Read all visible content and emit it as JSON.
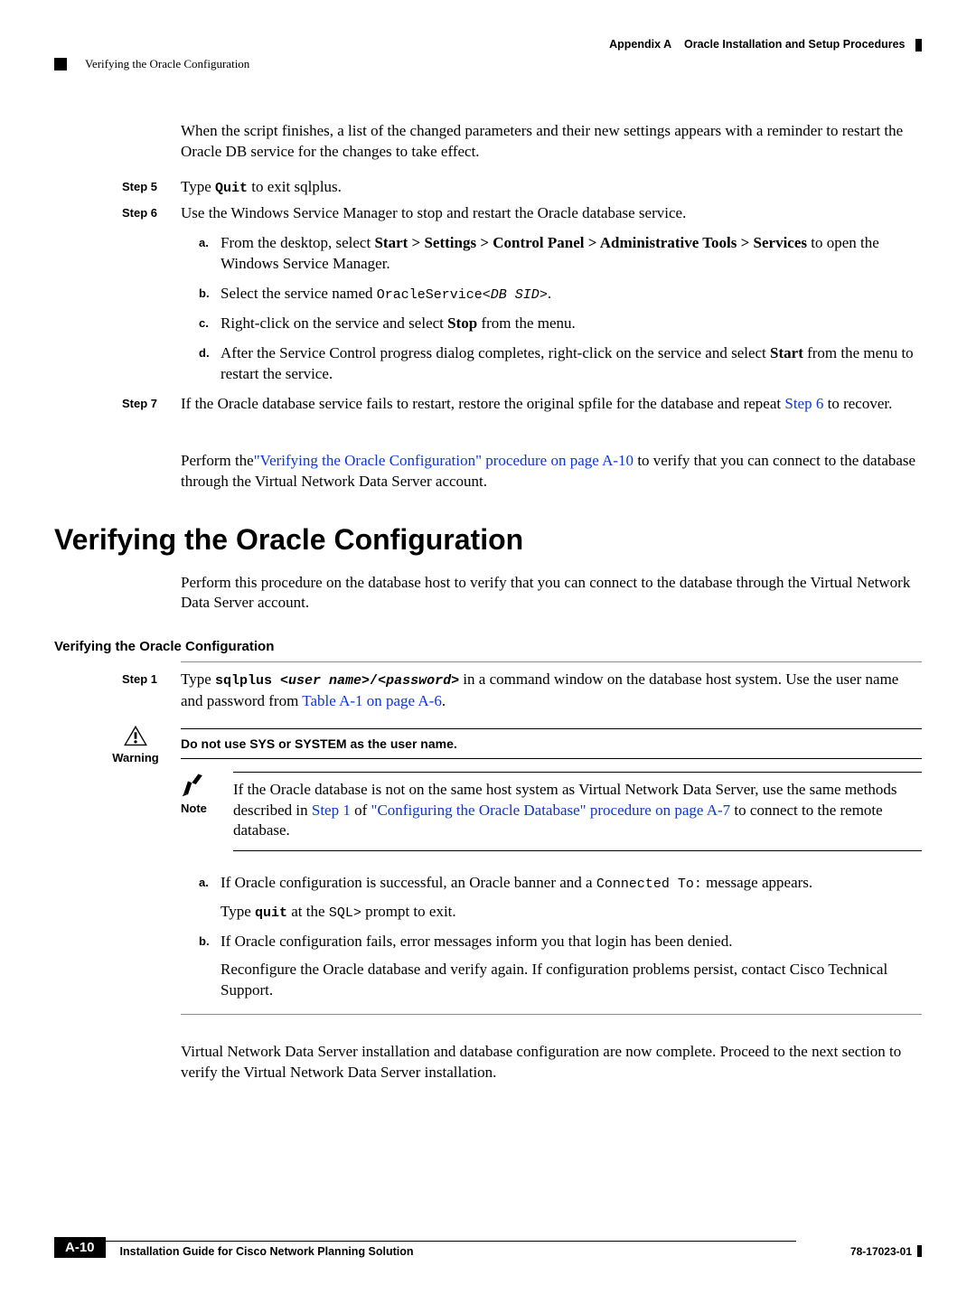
{
  "header": {
    "appendix": "Appendix A",
    "appendix_title": "Oracle Installation and Setup Procedures",
    "section": "Verifying the Oracle Configuration"
  },
  "continuation": {
    "intro": "When the script finishes, a list of the changed parameters and their new settings appears with a reminder to restart the Oracle DB service for the changes to take effect.",
    "step5_label": "Step 5",
    "step5_a": "Type ",
    "step5_cmd": "Quit",
    "step5_b": " to exit sqlplus.",
    "step6_label": "Step 6",
    "step6_text": "Use the Windows Service Manager to stop and restart the Oracle database service.",
    "step6a_a": "From the desktop, select ",
    "step6a_bold": "Start > Settings > Control Panel > Administrative Tools > Services",
    "step6a_b": " to open the Windows Service Manager.",
    "step6b_a": "Select the service named ",
    "step6b_code1": "OracleService<",
    "step6b_code2": "DB SID",
    "step6b_code3": ">",
    "step6b_dot": ".",
    "step6c_a": "Right-click on the service and select ",
    "step6c_bold": "Stop",
    "step6c_b": " from the menu.",
    "step6d_a": "After the Service Control progress dialog completes, right-click on the service and select ",
    "step6d_bold": "Start",
    "step6d_b": " from the menu to restart the service.",
    "step7_label": "Step 7",
    "step7_a": "If the Oracle database service fails to restart, restore the original spfile for the database and repeat ",
    "step7_link": "Step 6",
    "step7_b": " to recover.",
    "perform_a": "Perform the",
    "perform_link": "\"Verifying the Oracle Configuration\" procedure on page A-10",
    "perform_b": " to verify that you can connect to the database through the Virtual Network Data Server account."
  },
  "section2": {
    "title": "Verifying the Oracle Configuration",
    "intro": "Perform this procedure on the database host to verify that you can connect to the database through the Virtual Network Data Server account.",
    "subhead": "Verifying the Oracle Configuration",
    "step1_label": "Step 1",
    "step1_a": "Type ",
    "step1_cmd1": "sqlplus ",
    "step1_cmd2": "<user name>",
    "step1_cmd3": "/",
    "step1_cmd4": "<password>",
    "step1_b": "  in a command window on the database host system. Use the user name and password from ",
    "step1_link": "Table A-1 on page A-6",
    "step1_c": ".",
    "warning_label": "Warning",
    "warning_text": "Do not use SYS or SYSTEM as the user name.",
    "note_label": "Note",
    "note_a": "If the Oracle database is not on the same host system as Virtual Network Data Server, use the same methods described in ",
    "note_link1": "Step 1",
    "note_mid": " of ",
    "note_link2": "\"Configuring the Oracle Database\" procedure on page A-7",
    "note_b": " to connect to the remote database.",
    "sa_a": "If Oracle configuration is successful, an Oracle banner and a ",
    "sa_code": "Connected To:",
    "sa_b": " message appears.",
    "sa2_a": "Type ",
    "sa2_code1": "quit",
    "sa2_b": " at the ",
    "sa2_code2": "SQL>",
    "sa2_c": " prompt to exit.",
    "sb_a": "If Oracle configuration fails, error messages inform you that login has been denied.",
    "sb2": "Reconfigure the Oracle database and verify again. If configuration problems persist, contact Cisco Technical Support.",
    "closing": "Virtual Network Data Server installation and database configuration are now complete. Proceed to the next section to verify the Virtual Network Data Server installation."
  },
  "footer": {
    "guide": "Installation Guide for Cisco Network Planning Solution",
    "page": "A-10",
    "docnum": "78-17023-01"
  },
  "sub_labels": {
    "a": "a.",
    "b": "b.",
    "c": "c.",
    "d": "d."
  }
}
